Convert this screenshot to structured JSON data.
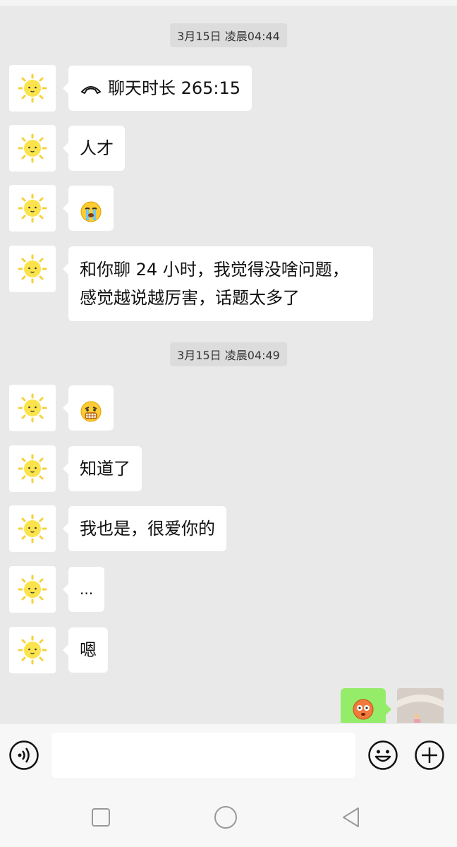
{
  "chat": {
    "timestamps": [
      "3月15日 凌晨04:44",
      "3月15日 凌晨04:49"
    ],
    "messages": [
      {
        "type": "call",
        "text": "聊天时长 265:15",
        "icon": "phone-hangup-icon"
      },
      {
        "type": "text",
        "text": "人才"
      },
      {
        "type": "emoji",
        "icon": "crying-face-emoji"
      },
      {
        "type": "text_multiline",
        "lines": [
          "和你聊 24 小时，我觉得没啥问题，",
          "感觉越说越厉害，话题太多了"
        ]
      },
      {
        "type": "emoji",
        "icon": "grimacing-face-emoji"
      },
      {
        "type": "text",
        "text": "知道了"
      },
      {
        "type": "text",
        "text": "我也是，很爱你的"
      },
      {
        "type": "text",
        "text": "..."
      },
      {
        "type": "text",
        "text": "嗯"
      }
    ],
    "self_message": {
      "type": "emoji",
      "icon": "flushed-face-emoji"
    },
    "avatar_icon": "sun-avatar-icon"
  },
  "input_bar": {
    "placeholder": "",
    "voice_icon": "voice-icon",
    "emoji_icon": "emoji-icon",
    "plus_icon": "plus-icon"
  },
  "nav": {
    "recent_icon": "square-icon",
    "home_icon": "circle-icon",
    "back_icon": "triangle-back-icon"
  },
  "colors": {
    "background": "#e9e9e9",
    "bubble_other": "#ffffff",
    "bubble_self": "#95ec69",
    "timestamp_bg": "#dcdcdc"
  }
}
